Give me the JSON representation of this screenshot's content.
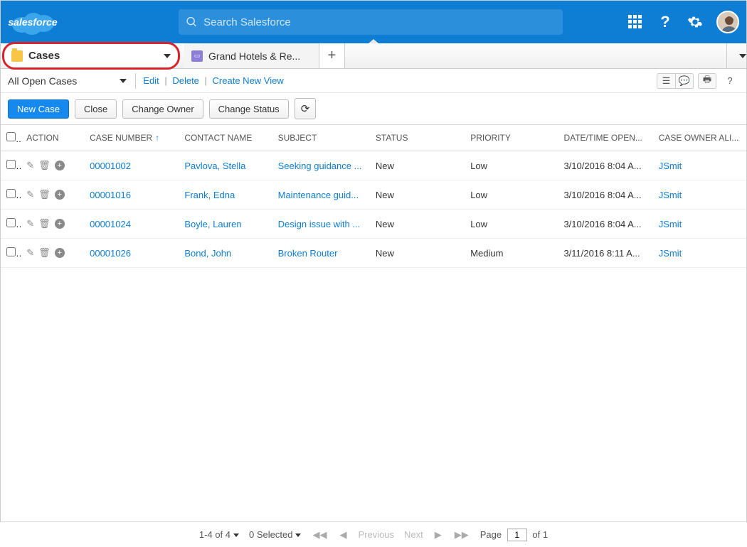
{
  "header": {
    "logo_text": "salesforce",
    "search_placeholder": "Search Salesforce"
  },
  "tabs": {
    "cases_label": "Cases",
    "second_label": "Grand Hotels & Re..."
  },
  "viewbar": {
    "view_name": "All Open Cases",
    "edit": "Edit",
    "delete": "Delete",
    "create": "Create New View"
  },
  "actions": {
    "new_case": "New Case",
    "close": "Close",
    "change_owner": "Change Owner",
    "change_status": "Change Status"
  },
  "table": {
    "headers": {
      "action": "ACTION",
      "case_number": "CASE NUMBER",
      "contact_name": "CONTACT NAME",
      "subject": "SUBJECT",
      "status": "STATUS",
      "priority": "PRIORITY",
      "date_opened": "DATE/TIME OPEN...",
      "owner": "CASE OWNER ALI..."
    },
    "rows": [
      {
        "case": "00001002",
        "contact": "Pavlova, Stella",
        "subject": "Seeking guidance ...",
        "status": "New",
        "priority": "Low",
        "date": "3/10/2016 8:04 A...",
        "owner": "JSmit"
      },
      {
        "case": "00001016",
        "contact": "Frank, Edna",
        "subject": "Maintenance guid...",
        "status": "New",
        "priority": "Low",
        "date": "3/10/2016 8:04 A...",
        "owner": "JSmit"
      },
      {
        "case": "00001024",
        "contact": "Boyle, Lauren",
        "subject": "Design issue with ...",
        "status": "New",
        "priority": "Low",
        "date": "3/10/2016 8:04 A...",
        "owner": "JSmit"
      },
      {
        "case": "00001026",
        "contact": "Bond, John",
        "subject": "Broken Router",
        "status": "New",
        "priority": "Medium",
        "date": "3/11/2016 8:11 A...",
        "owner": "JSmit"
      }
    ]
  },
  "footer": {
    "range": "1-4 of 4",
    "selected": "0 Selected",
    "previous": "Previous",
    "next": "Next",
    "page_label": "Page",
    "page_value": "1",
    "of_label": "of 1"
  }
}
